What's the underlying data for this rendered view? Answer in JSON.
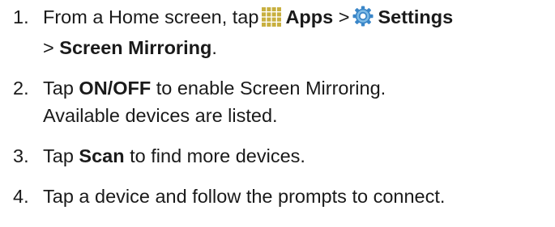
{
  "steps": [
    {
      "number": "1.",
      "parts": {
        "a": "From a Home screen, tap",
        "apps": "Apps",
        "gt1": ">",
        "settings": "Settings",
        "gt2": ">",
        "screen_mirroring": "Screen Mirroring",
        "period": "."
      },
      "icons": [
        "apps-grid-icon",
        "settings-gear-icon"
      ]
    },
    {
      "number": "2.",
      "parts": {
        "a": "Tap",
        "onoff": "ON/OFF",
        "b": "to enable Screen Mirroring.",
        "line2": "Available devices are listed."
      }
    },
    {
      "number": "3.",
      "parts": {
        "a": "Tap",
        "scan": "Scan",
        "b": "to find more devices."
      }
    },
    {
      "number": "4.",
      "parts": {
        "a": "Tap a device and follow the prompts to connect."
      }
    }
  ],
  "colors": {
    "text": "#1a1a1a",
    "apps_icon": "#c8b040",
    "settings_icon_ring": "#3a86c8",
    "settings_icon_fill": "#7fbbe6"
  }
}
